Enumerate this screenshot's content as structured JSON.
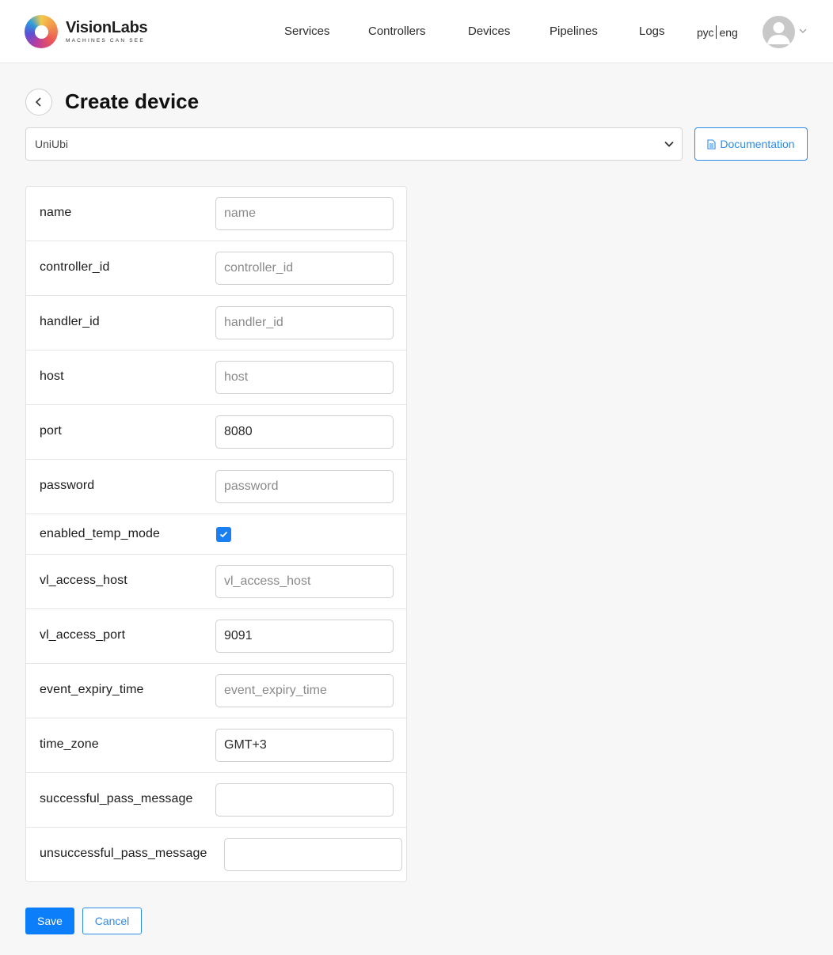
{
  "brand": {
    "name": "VisionLabs",
    "tagline": "MACHINES CAN SEE"
  },
  "nav": [
    {
      "label": "Services"
    },
    {
      "label": "Controllers"
    },
    {
      "label": "Devices"
    },
    {
      "label": "Pipelines"
    },
    {
      "label": "Logs"
    }
  ],
  "lang": {
    "ru": "рус",
    "en": "eng"
  },
  "page": {
    "title": "Create device"
  },
  "device_type": {
    "selected": "UniUbi"
  },
  "documentation": {
    "label": "Documentation"
  },
  "fields": [
    {
      "label": "name",
      "placeholder": "name",
      "value": ""
    },
    {
      "label": "controller_id",
      "placeholder": "controller_id",
      "value": ""
    },
    {
      "label": "handler_id",
      "placeholder": "handler_id",
      "value": ""
    },
    {
      "label": "host",
      "placeholder": "host",
      "value": ""
    },
    {
      "label": "port",
      "placeholder": "",
      "value": "8080"
    },
    {
      "label": "password",
      "placeholder": "password",
      "value": ""
    },
    {
      "label": "enabled_temp_mode",
      "checked": true
    },
    {
      "label": "vl_access_host",
      "placeholder": "vl_access_host",
      "value": ""
    },
    {
      "label": "vl_access_port",
      "placeholder": "",
      "value": "9091"
    },
    {
      "label": "event_expiry_time",
      "placeholder": "event_expiry_time",
      "value": ""
    },
    {
      "label": "time_zone",
      "placeholder": "",
      "value": "GMT+3"
    },
    {
      "label": "successful_pass_message",
      "placeholder": "",
      "value": ""
    },
    {
      "label": "unsuccessful_pass_message",
      "placeholder": "",
      "value": ""
    }
  ],
  "actions": {
    "save": "Save",
    "cancel": "Cancel"
  },
  "colors": {
    "primary": "#0d7ef9",
    "outline": "#2f8be6",
    "background": "#f7f7f7"
  }
}
